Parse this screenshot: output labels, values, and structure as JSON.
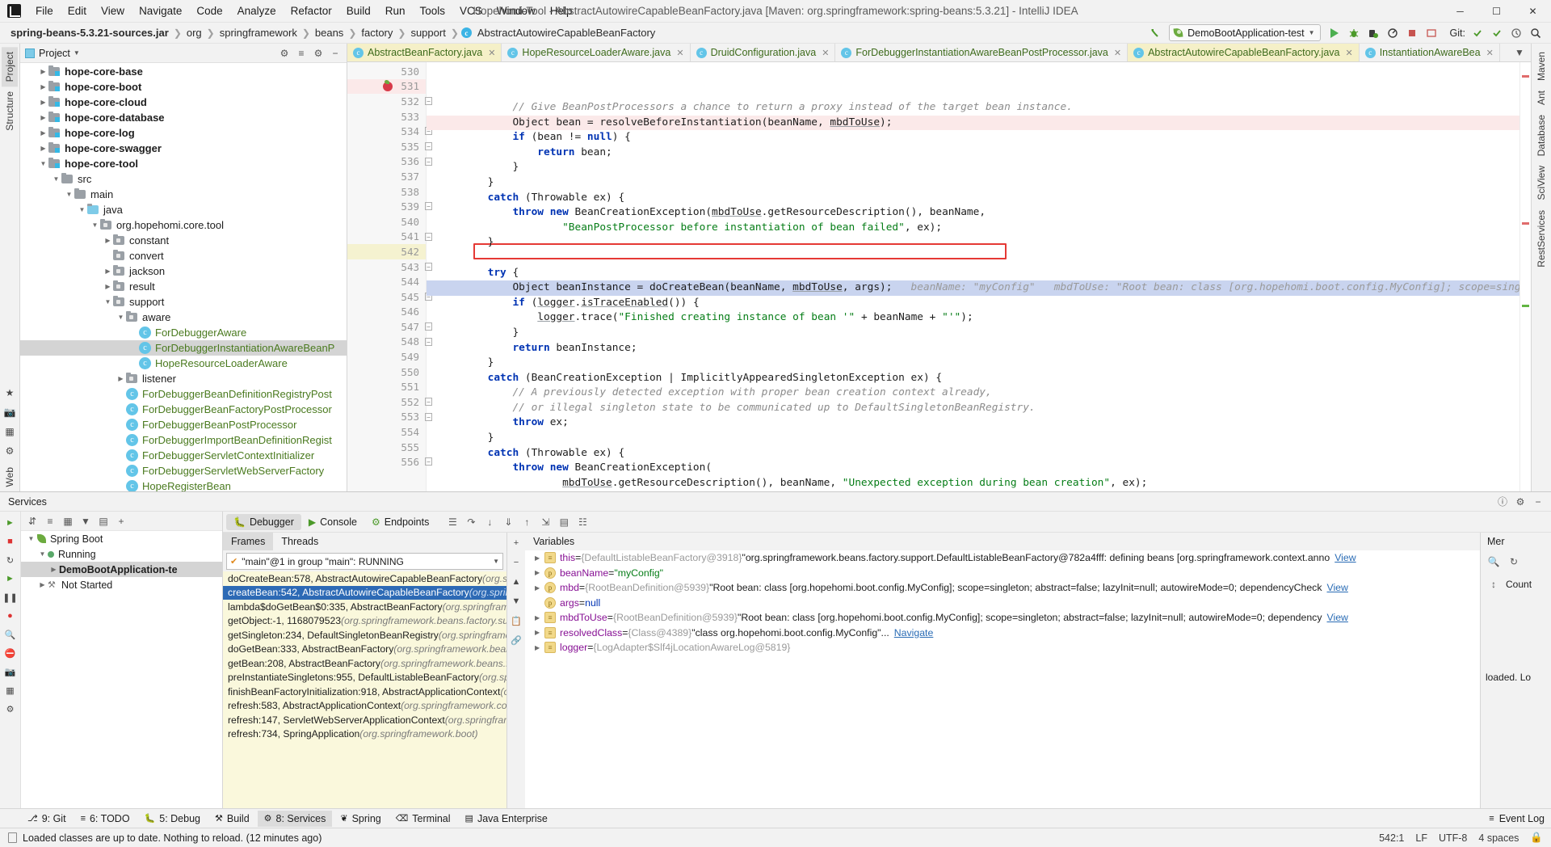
{
  "window": {
    "title": "Hopehomi-Tool - AbstractAutowireCapableBeanFactory.java [Maven: org.springframework:spring-beans:5.3.21] - IntelliJ IDEA",
    "minimize": "─",
    "maximize": "☐",
    "close": "✕"
  },
  "menubar": {
    "items": [
      "File",
      "Edit",
      "View",
      "Navigate",
      "Code",
      "Analyze",
      "Refactor",
      "Build",
      "Run",
      "Tools",
      "VCS",
      "Window",
      "Help"
    ]
  },
  "breadcrumb": {
    "items": [
      "spring-beans-5.3.21-sources.jar",
      "org",
      "springframework",
      "beans",
      "factory",
      "support",
      "AbstractAutowireCapableBeanFactory"
    ],
    "class_badge": "c"
  },
  "toolbar": {
    "run_config": "DemoBootApplication-test",
    "git_label": "Git:",
    "build_icon": "build-hammer-icon",
    "run_icon": "run-icon",
    "debug_icon": "debug-icon",
    "coverage_icon": "coverage-icon",
    "profile_icon": "profile-icon",
    "stop_icon": "stop-icon",
    "search_icon": "search-icon"
  },
  "left_strip": {
    "tabs": [
      "Project",
      "Structure"
    ],
    "bookmarks": "Favorites"
  },
  "right_strip": {
    "tabs": [
      "Maven",
      "Ant",
      "Database",
      "SciView",
      "RestServices"
    ]
  },
  "project_panel": {
    "title": "Project",
    "tree": [
      {
        "depth": 1,
        "arrow": "right",
        "icon": "module",
        "label": "hope-core-base",
        "bold": true,
        "clipped": true
      },
      {
        "depth": 1,
        "arrow": "right",
        "icon": "module",
        "label": "hope-core-boot",
        "bold": true
      },
      {
        "depth": 1,
        "arrow": "right",
        "icon": "module",
        "label": "hope-core-cloud",
        "bold": true
      },
      {
        "depth": 1,
        "arrow": "right",
        "icon": "module",
        "label": "hope-core-database",
        "bold": true
      },
      {
        "depth": 1,
        "arrow": "right",
        "icon": "module",
        "label": "hope-core-log",
        "bold": true
      },
      {
        "depth": 1,
        "arrow": "right",
        "icon": "module",
        "label": "hope-core-swagger",
        "bold": true
      },
      {
        "depth": 1,
        "arrow": "down",
        "icon": "module",
        "label": "hope-core-tool",
        "bold": true
      },
      {
        "depth": 2,
        "arrow": "down",
        "icon": "folder",
        "label": "src"
      },
      {
        "depth": 3,
        "arrow": "down",
        "icon": "folder",
        "label": "main"
      },
      {
        "depth": 4,
        "arrow": "down",
        "icon": "source",
        "label": "java"
      },
      {
        "depth": 5,
        "arrow": "down",
        "icon": "package",
        "label": "org.hopehomi.core.tool"
      },
      {
        "depth": 6,
        "arrow": "right",
        "icon": "package",
        "label": "constant"
      },
      {
        "depth": 6,
        "arrow": "none",
        "icon": "package",
        "label": "convert"
      },
      {
        "depth": 6,
        "arrow": "right",
        "icon": "package",
        "label": "jackson"
      },
      {
        "depth": 6,
        "arrow": "right",
        "icon": "package",
        "label": "result"
      },
      {
        "depth": 6,
        "arrow": "down",
        "icon": "package",
        "label": "support"
      },
      {
        "depth": 7,
        "arrow": "down",
        "icon": "package",
        "label": "aware"
      },
      {
        "depth": 8,
        "arrow": "none",
        "icon": "class",
        "label": "ForDebuggerAware",
        "java": true
      },
      {
        "depth": 8,
        "arrow": "none",
        "icon": "class",
        "label": "ForDebuggerInstantiationAwareBeanP",
        "java": true,
        "selected": true
      },
      {
        "depth": 8,
        "arrow": "none",
        "icon": "class",
        "label": "HopeResourceLoaderAware",
        "java": true
      },
      {
        "depth": 7,
        "arrow": "right",
        "icon": "package",
        "label": "listener"
      },
      {
        "depth": 7,
        "arrow": "none",
        "icon": "class",
        "label": "ForDebuggerBeanDefinitionRegistryPost",
        "java": true
      },
      {
        "depth": 7,
        "arrow": "none",
        "icon": "class",
        "label": "ForDebuggerBeanFactoryPostProcessor",
        "java": true
      },
      {
        "depth": 7,
        "arrow": "none",
        "icon": "class",
        "label": "ForDebuggerBeanPostProcessor",
        "java": true
      },
      {
        "depth": 7,
        "arrow": "none",
        "icon": "class",
        "label": "ForDebuggerImportBeanDefinitionRegist",
        "java": true
      },
      {
        "depth": 7,
        "arrow": "none",
        "icon": "class",
        "label": "ForDebuggerServletContextInitializer",
        "java": true
      },
      {
        "depth": 7,
        "arrow": "none",
        "icon": "class",
        "label": "ForDebuggerServletWebServerFactory",
        "java": true
      },
      {
        "depth": 7,
        "arrow": "none",
        "icon": "class",
        "label": "HopeRegisterBean",
        "java": true
      }
    ]
  },
  "editor": {
    "tabs": [
      {
        "label": "AbstractBeanFactory.java",
        "active": true,
        "badge": "c"
      },
      {
        "label": "HopeResourceLoaderAware.java",
        "active": false,
        "badge": "c"
      },
      {
        "label": "DruidConfiguration.java",
        "active": false,
        "badge": "c"
      },
      {
        "label": "ForDebuggerInstantiationAwareBeanPostProcessor.java",
        "active": false,
        "badge": "c"
      },
      {
        "label": "AbstractAutowireCapableBeanFactory.java",
        "active": true,
        "badge": "c"
      },
      {
        "label": "InstantiationAwareBea",
        "active": false,
        "badge": "c"
      }
    ],
    "lines": [
      {
        "num": 530,
        "html": "            <span class=\"cm\">// Give BeanPostProcessors a chance to return a proxy instead of the target bean instance.</span>"
      },
      {
        "num": 531,
        "html": "            Object bean = resolveBeforeInstantiation(beanName, <span class=\"und\">mbdToUse</span>);",
        "bp": true,
        "hl": "red"
      },
      {
        "num": 532,
        "html": "            <span class=\"kw\">if</span> (bean != <span class=\"kw\">null</span>) {",
        "fold": true
      },
      {
        "num": 533,
        "html": "                <span class=\"kw\">return</span> bean;"
      },
      {
        "num": 534,
        "html": "            }",
        "fold": true
      },
      {
        "num": 535,
        "html": "        }",
        "fold": true
      },
      {
        "num": 536,
        "html": "        <span class=\"kw\">catch</span> (Throwable ex) {",
        "fold": true
      },
      {
        "num": 537,
        "html": "            <span class=\"kw\">throw</span> <span class=\"kw\">new</span> BeanCreationException(<span class=\"und\">mbdToUse</span>.getResourceDescription(), beanName,"
      },
      {
        "num": 538,
        "html": "                    <span class=\"str\">\"BeanPostProcessor before instantiation of bean failed\"</span>, ex);"
      },
      {
        "num": 539,
        "html": "        }",
        "fold": true
      },
      {
        "num": 540,
        "html": ""
      },
      {
        "num": 541,
        "html": "        <span class=\"kw\">try</span> {",
        "fold": true
      },
      {
        "num": 542,
        "html": "            Object beanInstance = doCreateBean(beanName, <span class=\"und\">mbdToUse</span>, args);   <span class=\"hint\">beanName: \"myConfig\"   mbdToUse: \"Root bean: class [org.hopehomi.boot.config.MyConfig]; scope=singl</span>",
        "exec": true,
        "box": true
      },
      {
        "num": 543,
        "html": "            <span class=\"kw\">if</span> (<span class=\"und\">logger</span>.<span class=\"und\">isTraceEnabled</span>()) {",
        "fold": true
      },
      {
        "num": 544,
        "html": "                <span class=\"und\">logger</span>.trace(<span class=\"str\">\"Finished creating instance of bean '\"</span> + beanName + <span class=\"str\">\"'\"</span>);"
      },
      {
        "num": 545,
        "html": "            }",
        "fold": true
      },
      {
        "num": 546,
        "html": "            <span class=\"kw\">return</span> beanInstance;"
      },
      {
        "num": 547,
        "html": "        }",
        "fold": true
      },
      {
        "num": 548,
        "html": "        <span class=\"kw\">catch</span> (BeanCreationException | ImplicitlyAppearedSingletonException ex) {",
        "fold": true
      },
      {
        "num": 549,
        "html": "            <span class=\"cm\">// A previously detected exception with proper bean creation context already,</span>"
      },
      {
        "num": 550,
        "html": "            <span class=\"cm\">// or illegal singleton state to be communicated up to DefaultSingletonBeanRegistry.</span>"
      },
      {
        "num": 551,
        "html": "            <span class=\"kw\">throw</span> ex;"
      },
      {
        "num": 552,
        "html": "        }",
        "fold": true
      },
      {
        "num": 553,
        "html": "        <span class=\"kw\">catch</span> (Throwable ex) {",
        "fold": true
      },
      {
        "num": 554,
        "html": "            <span class=\"kw\">throw</span> <span class=\"kw\">new</span> BeanCreationException("
      },
      {
        "num": 555,
        "html": "                    <span class=\"und\">mbdToUse</span>.getResourceDescription(), beanName, <span class=\"str\">\"Unexpected exception during bean creation\"</span>, ex);"
      },
      {
        "num": 556,
        "html": "        }",
        "fold": true
      }
    ]
  },
  "services": {
    "title": "Services",
    "tree": [
      {
        "depth": 0,
        "arrow": "down",
        "icon": "spring",
        "label": "Spring Boot",
        "bold": false
      },
      {
        "depth": 1,
        "arrow": "down",
        "icon": "running",
        "label": "Running"
      },
      {
        "depth": 2,
        "arrow": "right",
        "icon": "none",
        "label": "DemoBootApplication-te",
        "bold": true,
        "selected": true
      },
      {
        "depth": 1,
        "arrow": "right",
        "icon": "wrench",
        "label": "Not Started"
      }
    ]
  },
  "debugger": {
    "tabs": [
      "Debugger",
      "Console",
      "Endpoints"
    ],
    "active_tab": "Debugger",
    "frames_tab": "Frames",
    "threads_tab": "Threads",
    "variables_title": "Variables",
    "thread_selector": "\"main\"@1 in group \"main\": RUNNING",
    "frames": [
      {
        "method": "doCreateBean:578, AbstractAutowireCapableBeanFactory",
        "pkg": "(org.springfra",
        "selected": false
      },
      {
        "method": "createBean:542, AbstractAutowireCapableBeanFactory",
        "pkg": "(org.springfra",
        "selected": true
      },
      {
        "method": "lambda$doGetBean$0:335, AbstractBeanFactory",
        "pkg": "(org.springframework",
        "selected": false
      },
      {
        "method": "getObject:-1, 1168079523",
        "pkg": "(org.springframework.beans.factory.suppo",
        "selected": false
      },
      {
        "method": "getSingleton:234, DefaultSingletonBeanRegistry",
        "pkg": "(org.springframework",
        "selected": false
      },
      {
        "method": "doGetBean:333, AbstractBeanFactory",
        "pkg": "(org.springframework.beans.fac",
        "selected": false
      },
      {
        "method": "getBean:208, AbstractBeanFactory",
        "pkg": "(org.springframework.beans.factor",
        "selected": false
      },
      {
        "method": "preInstantiateSingletons:955, DefaultListableBeanFactory",
        "pkg": "(org.springfr",
        "selected": false
      },
      {
        "method": "finishBeanFactoryInitialization:918, AbstractApplicationContext",
        "pkg": "(org.sp",
        "selected": false
      },
      {
        "method": "refresh:583, AbstractApplicationContext",
        "pkg": "(org.springframework.context",
        "selected": false
      },
      {
        "method": "refresh:147, ServletWebServerApplicationContext",
        "pkg": "(org.springframewo",
        "selected": false
      },
      {
        "method": "refresh:734, SpringApplication",
        "pkg": "(org.springframework.boot)",
        "selected": false
      }
    ],
    "variables": [
      {
        "icon": "stack",
        "name": "this",
        "eq": " = ",
        "type": "{DefaultListableBeanFactory@3918}",
        "value": "\"org.springframework.beans.factory.support.DefaultListableBeanFactory@782a4fff: defining beans [org.springframework.context.anno",
        "link": "View",
        "expandable": true
      },
      {
        "icon": "p",
        "name": "beanName",
        "eq": " = ",
        "type": "",
        "value": "\"myConfig\"",
        "str": true,
        "expandable": true
      },
      {
        "icon": "p",
        "name": "mbd",
        "eq": " = ",
        "type": "{RootBeanDefinition@5939}",
        "value": "\"Root bean: class [org.hopehomi.boot.config.MyConfig]; scope=singleton; abstract=false; lazyInit=null; autowireMode=0; dependencyCheck",
        "link": "View",
        "expandable": true
      },
      {
        "icon": "p",
        "name": "args",
        "eq": " = ",
        "type": "",
        "value": "null",
        "null": true,
        "expandable": false
      },
      {
        "icon": "stack",
        "name": "mbdToUse",
        "eq": " = ",
        "type": "{RootBeanDefinition@5939}",
        "value": "\"Root bean: class [org.hopehomi.boot.config.MyConfig]; scope=singleton; abstract=false; lazyInit=null; autowireMode=0; dependency",
        "link": "View",
        "expandable": true
      },
      {
        "icon": "stack",
        "name": "resolvedClass",
        "eq": " = ",
        "type": "{Class@4389}",
        "value": "\"class org.hopehomi.boot.config.MyConfig\"",
        "ellipsis": "...",
        "link": "Navigate",
        "expandable": true
      },
      {
        "icon": "stack",
        "name": "logger",
        "eq": " = ",
        "type": "{LogAdapter$Slf4jLocationAwareLog@5819}",
        "value": "",
        "expandable": true
      }
    ],
    "mer_title": "Mer",
    "mer_count": "Count",
    "mer_loaded": "loaded. Lo"
  },
  "toolwindow_bar": {
    "items": [
      {
        "label": "9: Git",
        "icon": "git-icon",
        "active": false
      },
      {
        "label": "6: TODO",
        "icon": "todo-icon",
        "active": false
      },
      {
        "label": "5: Debug",
        "icon": "debug-icon",
        "active": false
      },
      {
        "label": "Build",
        "icon": "build-icon",
        "active": false
      },
      {
        "label": "8: Services",
        "icon": "services-icon",
        "active": true
      },
      {
        "label": "Spring",
        "icon": "spring-icon",
        "active": false
      },
      {
        "label": "Terminal",
        "icon": "terminal-icon",
        "active": false
      },
      {
        "label": "Java Enterprise",
        "icon": "java-enterprise-icon",
        "active": false
      }
    ],
    "event_log": "Event Log"
  },
  "statusbar": {
    "message": "Loaded classes are up to date. Nothing to reload. (12 minutes ago)",
    "caret": "542:1",
    "line_sep": "LF",
    "encoding": "UTF-8",
    "indent": "4 spaces",
    "lock_icon": "lock-icon"
  }
}
